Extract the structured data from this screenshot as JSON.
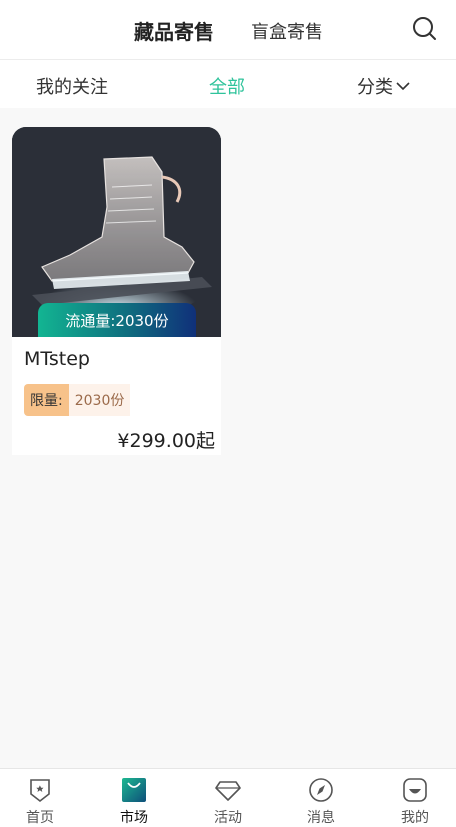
{
  "header": {
    "main_tab": "藏品寄售",
    "blind_box_tab": "盲盒寄售",
    "search_icon": "search-icon"
  },
  "subnav": {
    "follow": "我的关注",
    "all": "全部",
    "category": "分类",
    "active": "all",
    "accent_color": "#2fc39b"
  },
  "products": [
    {
      "circulation": "流通量:2030份",
      "title": "MTstep",
      "limit_label": "限量:",
      "limit_value": "2030份",
      "price": "¥299.00起",
      "image": "glass-sneaker-image"
    }
  ],
  "bottom_nav": {
    "items": [
      {
        "label": "首页",
        "icon": "home-shield-icon"
      },
      {
        "label": "市场",
        "icon": "market-bag-icon",
        "active": true
      },
      {
        "label": "活动",
        "icon": "diamond-icon"
      },
      {
        "label": "消息",
        "icon": "compass-icon"
      },
      {
        "label": "我的",
        "icon": "profile-icon"
      }
    ]
  }
}
